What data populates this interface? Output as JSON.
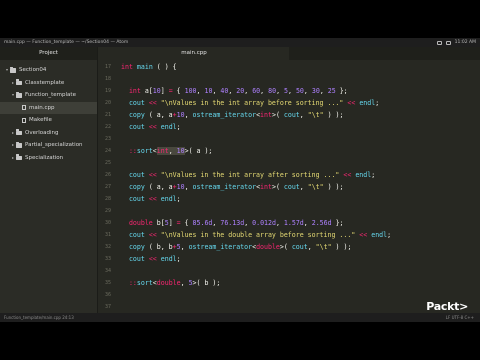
{
  "window": {
    "title": "main.cpp — Function_template — ~/Section04 — Atom",
    "clock": "11:02 AM"
  },
  "sidebar": {
    "header": "Project",
    "items": [
      {
        "label": "Section04",
        "type": "folder",
        "expanded": true,
        "depth": 0
      },
      {
        "label": "Classtemplate",
        "type": "folder",
        "expanded": false,
        "depth": 1
      },
      {
        "label": "Function_template",
        "type": "folder",
        "expanded": true,
        "depth": 1
      },
      {
        "label": "main.cpp",
        "type": "file",
        "selected": true,
        "depth": 2
      },
      {
        "label": "Makefile",
        "type": "file",
        "depth": 2
      },
      {
        "label": "Overloading",
        "type": "folder",
        "expanded": false,
        "depth": 1
      },
      {
        "label": "Partial_specialization",
        "type": "folder",
        "expanded": false,
        "depth": 1
      },
      {
        "label": "Specialization",
        "type": "folder",
        "expanded": false,
        "depth": 1
      }
    ]
  },
  "tab": {
    "label": "main.cpp"
  },
  "code_lines": [
    {
      "num": "17",
      "text": "int main ( ) {"
    },
    {
      "num": "18",
      "text": ""
    },
    {
      "num": "19",
      "text": "  int a[10] = { 100, 10, 40, 20, 60, 80, 5, 50, 30, 25 };"
    },
    {
      "num": "20",
      "text": "  cout << \"\\nValues in the int array before sorting ...\" << endl;"
    },
    {
      "num": "21",
      "text": "  copy ( a, a+10, ostream_iterator<int>( cout, \"\\t\" ) );"
    },
    {
      "num": "22",
      "text": "  cout << endl;"
    },
    {
      "num": "23",
      "text": ""
    },
    {
      "num": "24",
      "text": "  ::sort<int, 10>( a );"
    },
    {
      "num": "25",
      "text": ""
    },
    {
      "num": "26",
      "text": "  cout << \"\\nValues in the int array after sorting ...\" << endl;"
    },
    {
      "num": "27",
      "text": "  copy ( a, a+10, ostream_iterator<int>( cout, \"\\t\" ) );"
    },
    {
      "num": "28",
      "text": "  cout << endl;"
    },
    {
      "num": "29",
      "text": ""
    },
    {
      "num": "30",
      "text": "  double b[5] = { 85.6d, 76.13d, 0.012d, 1.57d, 2.56d };"
    },
    {
      "num": "31",
      "text": "  cout << \"\\nValues in the double array before sorting ...\" << endl;"
    },
    {
      "num": "32",
      "text": "  copy ( b, b+5, ostream_iterator<double>( cout, \"\\t\" ) );"
    },
    {
      "num": "33",
      "text": "  cout << endl;"
    },
    {
      "num": "34",
      "text": ""
    },
    {
      "num": "35",
      "text": "  ::sort<double, 5>( b );"
    },
    {
      "num": "36",
      "text": ""
    },
    {
      "num": "37",
      "text": ""
    }
  ],
  "status": {
    "left": "Function_template/main.cpp   24:13",
    "right": "LF   UTF-8   C++"
  },
  "watermark": "Packt>",
  "colors": {
    "keyword": "#f92672",
    "type": "#66d9ef",
    "number": "#ae81ff",
    "string": "#e6db74",
    "text": "#f8f8f2",
    "background": "#272822"
  }
}
